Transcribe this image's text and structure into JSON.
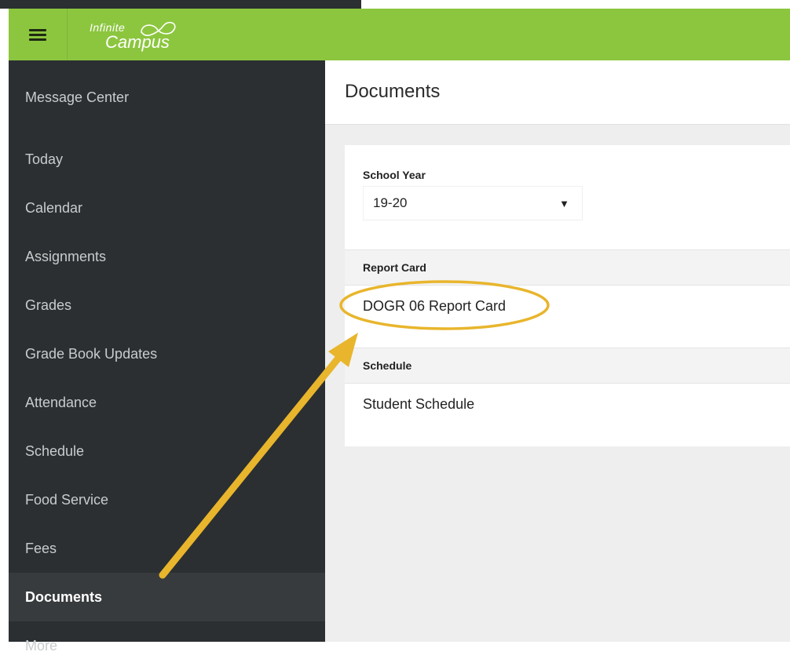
{
  "header": {
    "logo_line1": "Infinite",
    "logo_line2": "Campus",
    "accent_color": "#8cc63f"
  },
  "sidebar": {
    "items": [
      {
        "label": "Message Center",
        "active": false
      },
      {
        "label": "Today",
        "active": false
      },
      {
        "label": "Calendar",
        "active": false
      },
      {
        "label": "Assignments",
        "active": false
      },
      {
        "label": "Grades",
        "active": false
      },
      {
        "label": "Grade Book Updates",
        "active": false
      },
      {
        "label": "Attendance",
        "active": false
      },
      {
        "label": "Schedule",
        "active": false
      },
      {
        "label": "Food Service",
        "active": false
      },
      {
        "label": "Fees",
        "active": false
      },
      {
        "label": "Documents",
        "active": true
      },
      {
        "label": "More",
        "active": false
      }
    ]
  },
  "main": {
    "title": "Documents",
    "school_year": {
      "label": "School Year",
      "value": "19-20"
    },
    "sections": [
      {
        "heading": "Report Card",
        "documents": [
          "DOGR 06 Report Card"
        ]
      },
      {
        "heading": "Schedule",
        "documents": [
          "Student Schedule"
        ]
      }
    ]
  },
  "annotation": {
    "highlight_color": "#e8b52c"
  }
}
